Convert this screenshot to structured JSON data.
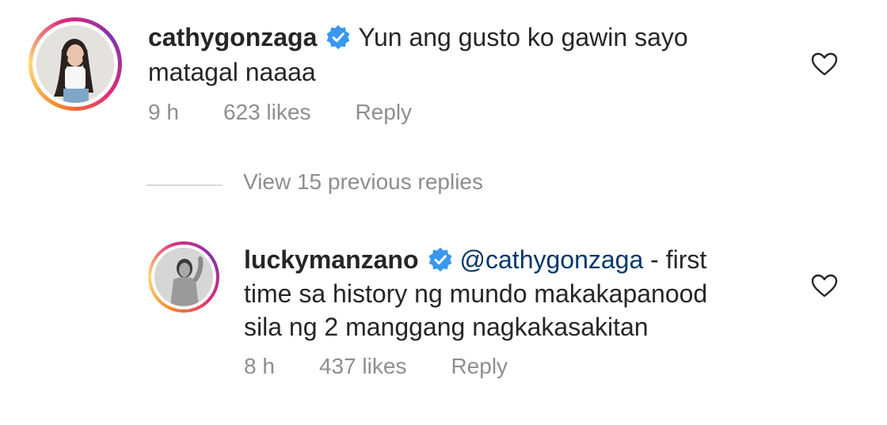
{
  "comment1": {
    "username": "cathygonzaga",
    "text_line1": "Yun ang gusto ko gawin sayo",
    "text_line2": "matagal naaaa",
    "time": "9 h",
    "likes": "623 likes",
    "reply": "Reply"
  },
  "view_replies": "View 15 previous replies",
  "comment2": {
    "username": "luckymanzano",
    "mention": "@cathygonzaga",
    "text_line1_rest": " - first",
    "text_line2": "time sa history ng mundo makakapanood",
    "text_line3": "sila ng 2 manggang nagkakasakitan",
    "time": "8 h",
    "likes": "437 likes",
    "reply": "Reply"
  },
  "colors": {
    "verified": "#3897f0",
    "meta": "#8e8e8e",
    "mention": "#00376b"
  },
  "icons": [
    "verified-badge-icon",
    "heart-icon"
  ]
}
